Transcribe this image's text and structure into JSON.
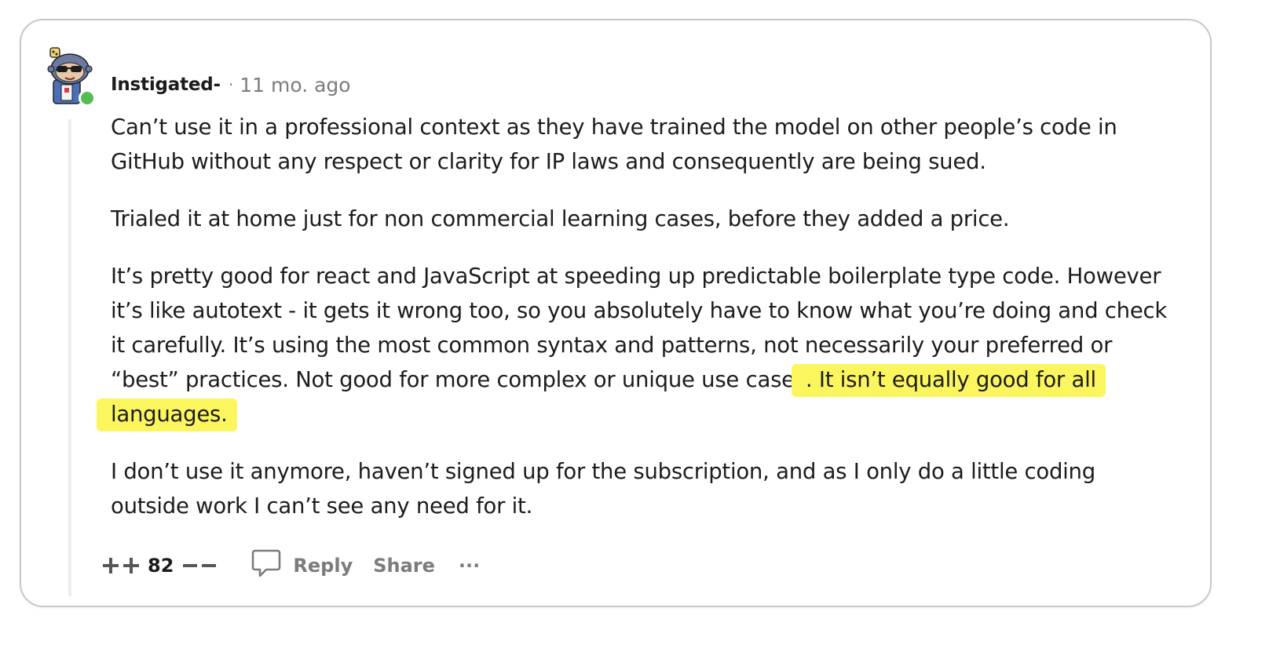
{
  "comment": {
    "username": "Instigated-",
    "separator": "·",
    "timestamp": "11 mo. ago",
    "paragraphs": [
      {
        "text": "Can’t use it in a professional context as they have trained the model on other people’s code in GitHub without any respect or clarity for IP laws and consequently are being sued.",
        "highlight": ""
      },
      {
        "text": "Trialed it at home just for non commercial learning cases, before they added a price.",
        "highlight": ""
      },
      {
        "text": "It’s pretty good for react and JavaScript at speeding up predictable boilerplate type code. However it’s like autotext - it gets it wrong too, so you absolutely have to know what you’re doing and check it carefully. It’s using the most common syntax and patterns, not necessarily your preferred or “best” practices. Not good for more complex or unique use cases",
        "highlight": ". It isn’t equally good for all languages."
      },
      {
        "text": "I don’t use it anymore, haven’t signed up for the subscription, and as I only do a little coding outside work I can’t see any need for it.",
        "highlight": ""
      }
    ]
  },
  "actions": {
    "score": "82",
    "reply_label": "Reply",
    "share_label": "Share",
    "more_label": "···"
  },
  "icons": {
    "upvote": "upvote-plus-icon",
    "downvote": "downvote-minus-icon",
    "reply": "comment-bubble-icon",
    "more": "more-dots-icon"
  },
  "colors": {
    "highlight": "#fbf65d",
    "online": "#55bd4f",
    "muted_text": "#7c7c7c",
    "thread_line": "#ededed"
  }
}
